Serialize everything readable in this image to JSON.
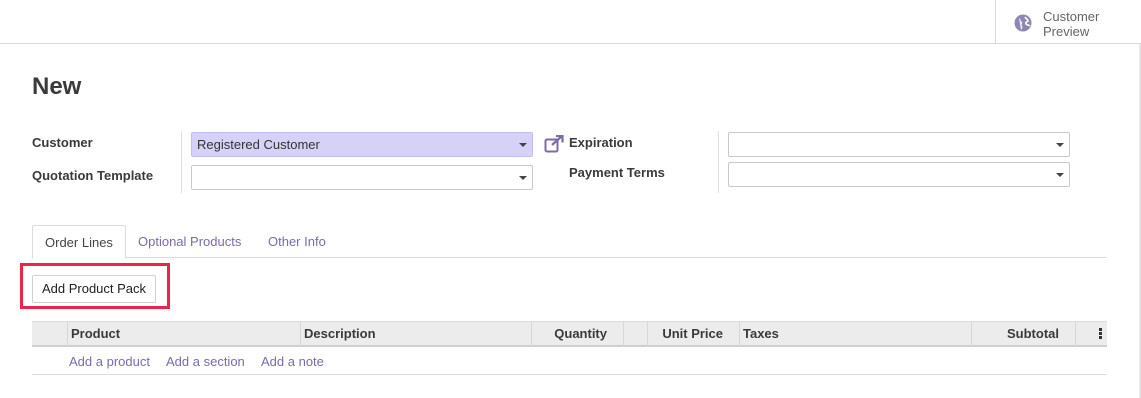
{
  "topbar": {
    "preview_label_1": "Customer",
    "preview_label_2": "Preview",
    "preview_icon": "globe-icon"
  },
  "form": {
    "title": "New",
    "customer_label": "Customer",
    "customer_value": "Registered Customer",
    "template_label": "Quotation Template",
    "template_value": "",
    "expiration_label": "Expiration",
    "expiration_value": "",
    "payment_terms_label": "Payment Terms",
    "payment_terms_value": "",
    "external_link_icon": "external-link-icon"
  },
  "tabs": [
    {
      "label": "Order Lines",
      "active": true
    },
    {
      "label": "Optional Products",
      "active": false
    },
    {
      "label": "Other Info",
      "active": false
    }
  ],
  "actions": {
    "add_pack_label": "Add Product Pack",
    "highlight_color": "#e8244f"
  },
  "table": {
    "columns": [
      "Product",
      "Description",
      "Quantity",
      "Unit Price",
      "Taxes",
      "Subtotal"
    ],
    "add_links": [
      "Add a product",
      "Add a section",
      "Add a note"
    ],
    "options_icon": "kebab-menu-icon"
  },
  "colors": {
    "accent": "#7c6ba8",
    "filled_field": "#d6d2f7"
  }
}
